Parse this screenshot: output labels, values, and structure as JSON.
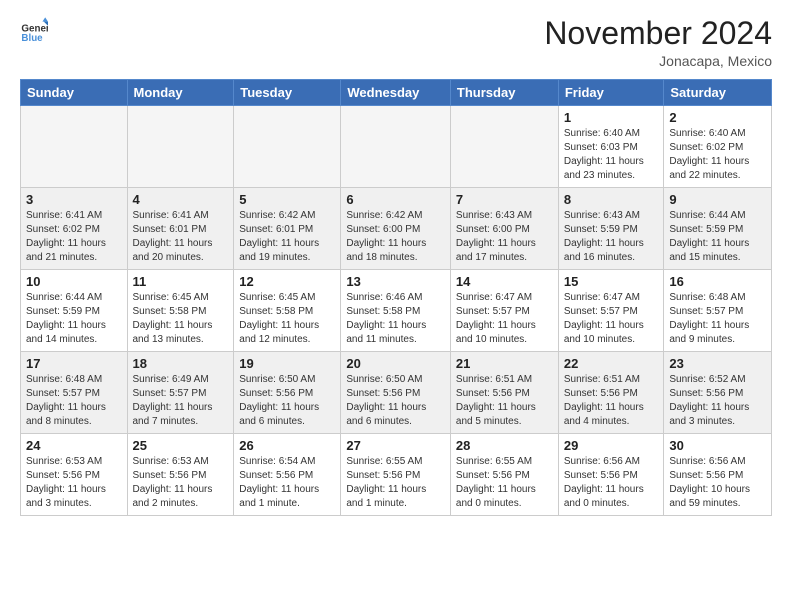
{
  "header": {
    "logo_general": "General",
    "logo_blue": "Blue",
    "month_title": "November 2024",
    "location": "Jonacapa, Mexico"
  },
  "columns": [
    "Sunday",
    "Monday",
    "Tuesday",
    "Wednesday",
    "Thursday",
    "Friday",
    "Saturday"
  ],
  "weeks": [
    {
      "shaded": false,
      "days": [
        {
          "num": "",
          "info": ""
        },
        {
          "num": "",
          "info": ""
        },
        {
          "num": "",
          "info": ""
        },
        {
          "num": "",
          "info": ""
        },
        {
          "num": "",
          "info": ""
        },
        {
          "num": "1",
          "info": "Sunrise: 6:40 AM\nSunset: 6:03 PM\nDaylight: 11 hours and 23 minutes."
        },
        {
          "num": "2",
          "info": "Sunrise: 6:40 AM\nSunset: 6:02 PM\nDaylight: 11 hours and 22 minutes."
        }
      ]
    },
    {
      "shaded": true,
      "days": [
        {
          "num": "3",
          "info": "Sunrise: 6:41 AM\nSunset: 6:02 PM\nDaylight: 11 hours and 21 minutes."
        },
        {
          "num": "4",
          "info": "Sunrise: 6:41 AM\nSunset: 6:01 PM\nDaylight: 11 hours and 20 minutes."
        },
        {
          "num": "5",
          "info": "Sunrise: 6:42 AM\nSunset: 6:01 PM\nDaylight: 11 hours and 19 minutes."
        },
        {
          "num": "6",
          "info": "Sunrise: 6:42 AM\nSunset: 6:00 PM\nDaylight: 11 hours and 18 minutes."
        },
        {
          "num": "7",
          "info": "Sunrise: 6:43 AM\nSunset: 6:00 PM\nDaylight: 11 hours and 17 minutes."
        },
        {
          "num": "8",
          "info": "Sunrise: 6:43 AM\nSunset: 5:59 PM\nDaylight: 11 hours and 16 minutes."
        },
        {
          "num": "9",
          "info": "Sunrise: 6:44 AM\nSunset: 5:59 PM\nDaylight: 11 hours and 15 minutes."
        }
      ]
    },
    {
      "shaded": false,
      "days": [
        {
          "num": "10",
          "info": "Sunrise: 6:44 AM\nSunset: 5:59 PM\nDaylight: 11 hours and 14 minutes."
        },
        {
          "num": "11",
          "info": "Sunrise: 6:45 AM\nSunset: 5:58 PM\nDaylight: 11 hours and 13 minutes."
        },
        {
          "num": "12",
          "info": "Sunrise: 6:45 AM\nSunset: 5:58 PM\nDaylight: 11 hours and 12 minutes."
        },
        {
          "num": "13",
          "info": "Sunrise: 6:46 AM\nSunset: 5:58 PM\nDaylight: 11 hours and 11 minutes."
        },
        {
          "num": "14",
          "info": "Sunrise: 6:47 AM\nSunset: 5:57 PM\nDaylight: 11 hours and 10 minutes."
        },
        {
          "num": "15",
          "info": "Sunrise: 6:47 AM\nSunset: 5:57 PM\nDaylight: 11 hours and 10 minutes."
        },
        {
          "num": "16",
          "info": "Sunrise: 6:48 AM\nSunset: 5:57 PM\nDaylight: 11 hours and 9 minutes."
        }
      ]
    },
    {
      "shaded": true,
      "days": [
        {
          "num": "17",
          "info": "Sunrise: 6:48 AM\nSunset: 5:57 PM\nDaylight: 11 hours and 8 minutes."
        },
        {
          "num": "18",
          "info": "Sunrise: 6:49 AM\nSunset: 5:57 PM\nDaylight: 11 hours and 7 minutes."
        },
        {
          "num": "19",
          "info": "Sunrise: 6:50 AM\nSunset: 5:56 PM\nDaylight: 11 hours and 6 minutes."
        },
        {
          "num": "20",
          "info": "Sunrise: 6:50 AM\nSunset: 5:56 PM\nDaylight: 11 hours and 6 minutes."
        },
        {
          "num": "21",
          "info": "Sunrise: 6:51 AM\nSunset: 5:56 PM\nDaylight: 11 hours and 5 minutes."
        },
        {
          "num": "22",
          "info": "Sunrise: 6:51 AM\nSunset: 5:56 PM\nDaylight: 11 hours and 4 minutes."
        },
        {
          "num": "23",
          "info": "Sunrise: 6:52 AM\nSunset: 5:56 PM\nDaylight: 11 hours and 3 minutes."
        }
      ]
    },
    {
      "shaded": false,
      "days": [
        {
          "num": "24",
          "info": "Sunrise: 6:53 AM\nSunset: 5:56 PM\nDaylight: 11 hours and 3 minutes."
        },
        {
          "num": "25",
          "info": "Sunrise: 6:53 AM\nSunset: 5:56 PM\nDaylight: 11 hours and 2 minutes."
        },
        {
          "num": "26",
          "info": "Sunrise: 6:54 AM\nSunset: 5:56 PM\nDaylight: 11 hours and 1 minute."
        },
        {
          "num": "27",
          "info": "Sunrise: 6:55 AM\nSunset: 5:56 PM\nDaylight: 11 hours and 1 minute."
        },
        {
          "num": "28",
          "info": "Sunrise: 6:55 AM\nSunset: 5:56 PM\nDaylight: 11 hours and 0 minutes."
        },
        {
          "num": "29",
          "info": "Sunrise: 6:56 AM\nSunset: 5:56 PM\nDaylight: 11 hours and 0 minutes."
        },
        {
          "num": "30",
          "info": "Sunrise: 6:56 AM\nSunset: 5:56 PM\nDaylight: 10 hours and 59 minutes."
        }
      ]
    }
  ]
}
